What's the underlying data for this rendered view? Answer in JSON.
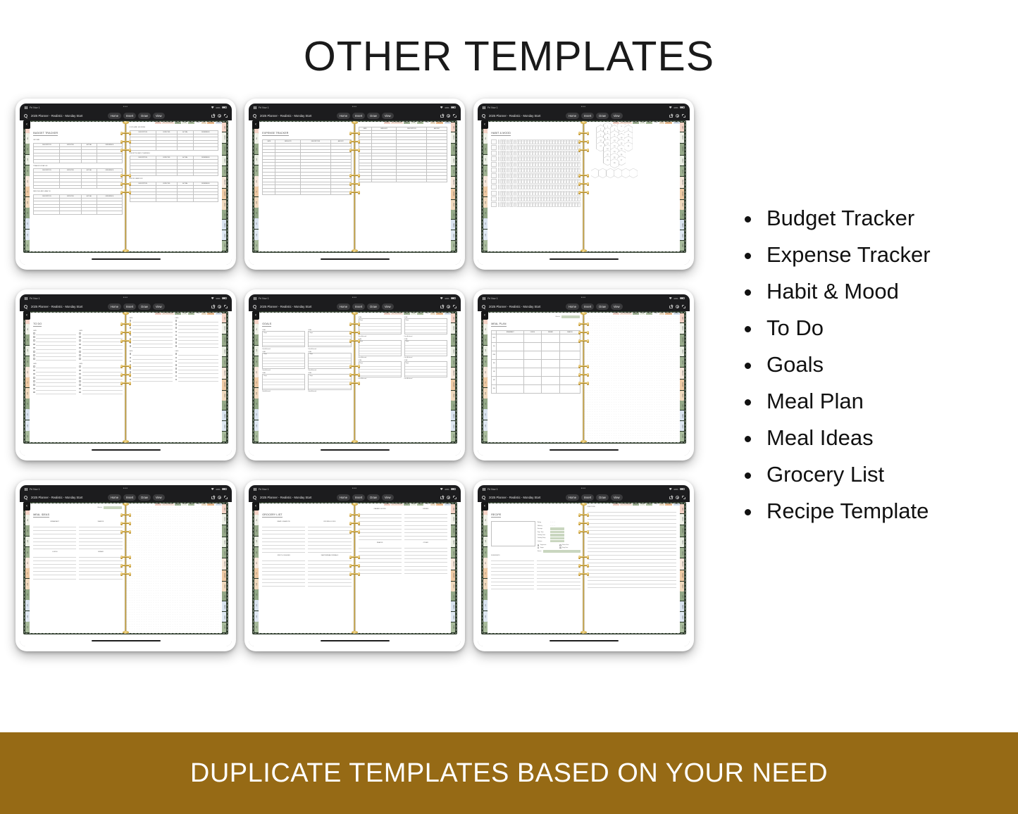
{
  "title": "OTHER TEMPLATES",
  "banner": {
    "text": "DUPLICATE TEMPLATES BASED ON YOUR NEED",
    "bg_color": "#966A15",
    "text_color": "#FFFFFF"
  },
  "bullets": [
    "Budget Tracker",
    "Expense Tracker",
    "Habit & Mood",
    "To Do",
    "Goals",
    "Meal Plan",
    "Meal Ideas",
    "Grocery List",
    "Recipe Template"
  ],
  "device": {
    "status_bar": {
      "time": "Fri Nov 1",
      "battery": "40%",
      "dots": "•••"
    },
    "toolbar": {
      "document_title": "2025 Planner - Realistic - Monday Start",
      "menus": [
        "Home",
        "Insert",
        "Draw",
        "View"
      ],
      "icons": [
        "search-icon",
        "share-icon",
        "gear-icon",
        "expand-icon"
      ]
    },
    "back_chevron": "‹"
  },
  "top_tabs": [
    {
      "label": "INDEX",
      "color": "#f0cfc4"
    },
    {
      "label": "INC / EXPENSE",
      "color": "#f3ded2"
    },
    {
      "label": "HABIT",
      "color": "#9cae90"
    },
    {
      "label": "GOAL",
      "color": "#e8ecdf"
    },
    {
      "label": "MEAL",
      "color": "#a9bb9b"
    },
    {
      "label": "IDEA",
      "color": "#ffffff"
    },
    {
      "label": "LIST",
      "color": "#ead9c0"
    },
    {
      "label": "RECIPE",
      "color": "#e9b98c"
    },
    {
      "label": "BLANK",
      "color": "#d7e2ee"
    }
  ],
  "side_tabs_left": [
    "JAN",
    "FEB",
    "MAR",
    "APR",
    "MAY",
    "JUN",
    "JUL",
    "AUG",
    "SEP",
    "OCT",
    "NOV",
    "DEC"
  ],
  "side_tabs_right": [
    "DAILY",
    "WEEKLY",
    "MONTHLY",
    "YEARLY",
    "NOTES",
    "TRACKER",
    "BUDGET",
    "MEALS",
    "LISTS",
    "HABITS",
    "GOALS",
    "BLANK"
  ],
  "tablets": [
    {
      "name": "budget-tracker",
      "page_title": "BUDGET TRACKER",
      "layout": "budget",
      "groups_left": [
        "INCOME",
        "TRANSPORTATION",
        "MEDICAL AND HEALTH"
      ],
      "groups_right": [
        "FOOD AND HOUSING",
        "INVESTING AND PLANNING",
        "MISCELLANEOUS"
      ],
      "columns": [
        "DESCRIPTION",
        "EXPECTED",
        "ACTUAL",
        "DIFFERENCE"
      ],
      "rows_per_group": 5
    },
    {
      "name": "expense-tracker",
      "page_title": "EXPENSE TRACKER",
      "layout": "expense",
      "columns": [
        "DATE",
        "CATEGORY",
        "DESCRIPTION",
        "AMOUNT"
      ],
      "rows": 16
    },
    {
      "name": "habit-and-mood",
      "page_title": "HABIT & MOOD",
      "layout": "habit",
      "habit_rows": 12,
      "days": 31,
      "mood_hex_numbers": [
        1,
        2,
        3,
        4,
        5,
        6,
        7,
        8,
        9,
        10,
        11,
        12,
        13,
        14,
        15,
        16,
        17,
        18,
        19,
        20,
        21,
        22,
        23,
        24,
        25,
        26,
        27,
        28,
        29,
        30,
        31
      ],
      "legend_hexes": 6
    },
    {
      "name": "to-do",
      "page_title": "TO DO",
      "layout": "todo",
      "column_label": "DATE",
      "columns": 4,
      "blocks": 2,
      "items_per_block": 8
    },
    {
      "name": "goals",
      "page_title": "GOALS",
      "layout": "goals",
      "box_label": "GOAL",
      "steps_label": "Steps",
      "achieved_label": "Date Achieved",
      "rows": 3,
      "cols": 4
    },
    {
      "name": "meal-plan",
      "page_title": "MEAL PLAN",
      "layout": "mealplan",
      "week_of_label": "Week of",
      "columns": [
        "BREAKFAST",
        "LUNCH",
        "DINNER",
        "SNACKS"
      ],
      "days": [
        "MON",
        "TUE",
        "WED",
        "THU",
        "FRI",
        "SAT",
        "SUN"
      ]
    },
    {
      "name": "meal-ideas",
      "page_title": "MEAL IDEAS",
      "layout": "mealideas",
      "week_of_label": "Week of",
      "sections": [
        "BREAKFAST",
        "SNACKS",
        "LUNCH",
        "DINNER"
      ],
      "lines_per_section": 7
    },
    {
      "name": "grocery-list",
      "page_title": "GROCERY LIST",
      "layout": "grocery",
      "sections_top": [
        "MEAT & SEAFOOD",
        "FROZEN GOODS",
        "CANNED GOODS",
        "DRINKS"
      ],
      "sections_bottom": [
        "FRUIT & VEGGIES",
        "DAIRY/BREAD/CEREALS",
        "SNACKS",
        "OTHER"
      ],
      "lines_per_section": 8
    },
    {
      "name": "recipe-template",
      "page_title": "RECIPE",
      "layout": "recipe",
      "fields": [
        "Rating",
        "Difficulty",
        "Servings",
        "Prep. Time",
        "Cooking Time",
        "Cooking Temp",
        "Calories"
      ],
      "checkboxes": [
        "Vegetarian",
        "Gluten Free",
        "Vegan",
        "Dairy Free"
      ],
      "source_label": "Source",
      "ingredients_label": "INGREDIENTS",
      "directions_label": "DIRECTIONS"
    }
  ]
}
